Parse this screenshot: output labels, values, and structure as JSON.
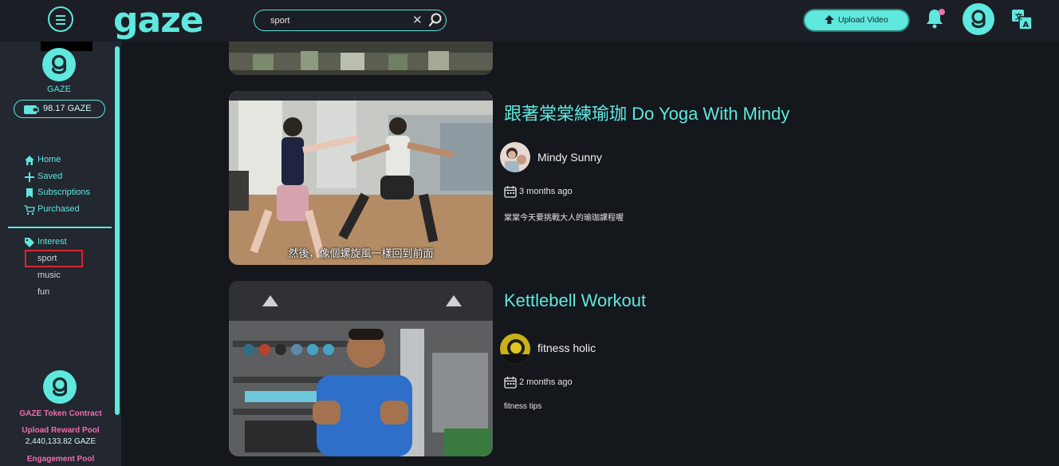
{
  "app": {
    "logo": "gaze"
  },
  "search": {
    "value": "sport",
    "placeholder": ""
  },
  "header": {
    "upload_label": "Upload Video"
  },
  "sidebar": {
    "user_name": "GAZE",
    "balance": "98.17 GAZE",
    "nav": [
      {
        "label": "Home",
        "icon": "home-icon"
      },
      {
        "label": "Saved",
        "icon": "plus-icon"
      },
      {
        "label": "Subscriptions",
        "icon": "bookmark-icon"
      },
      {
        "label": "Purchased",
        "icon": "cart-icon"
      }
    ],
    "interest_label": "Interest",
    "interests": [
      "sport",
      "music",
      "fun"
    ],
    "token_contract": "GAZE Token Contract",
    "upload_pool_label": "Upload Reward Pool",
    "upload_pool_value": "2,440,133.82 GAZE",
    "engagement_pool_label": "Engagement Pool"
  },
  "videos": [
    {
      "title": "跟著棠棠練瑜珈 Do Yoga With Mindy",
      "channel": "Mindy Sunny",
      "date": "3 months ago",
      "description": "棠棠今天要挑戰大人的瑜珈課程喔",
      "subtitle": "然後，像個螺旋風一樣回到前面"
    },
    {
      "title": "Kettlebell Workout",
      "channel": "fitness holic",
      "date": "2 months ago",
      "description": "fitness tips"
    }
  ],
  "colors": {
    "accent": "#5ee8de",
    "pink": "#f06db0",
    "background": "#14171c",
    "sidebar": "#222730"
  }
}
